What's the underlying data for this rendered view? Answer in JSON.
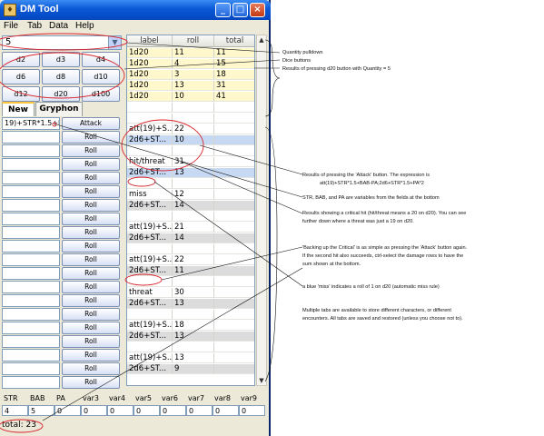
{
  "window": {
    "title": "DM Tool",
    "controls": [
      "_",
      "□",
      "×"
    ]
  },
  "menu": [
    "File",
    "Tab",
    "Data",
    "Help"
  ],
  "quantity": {
    "value": "5"
  },
  "dice": [
    "d2",
    "d3",
    "d4",
    "d6",
    "d8",
    "d10",
    "d12",
    "d20",
    "d100"
  ],
  "tabs": [
    "New",
    "Gryphon"
  ],
  "expressions": [
    {
      "text": "19)+STR*1.5+l",
      "button": "Attack"
    },
    {
      "text": "",
      "button": "Roll"
    },
    {
      "text": "",
      "button": "Roll"
    },
    {
      "text": "",
      "button": "Roll"
    },
    {
      "text": "",
      "button": "Roll"
    },
    {
      "text": "",
      "button": "Roll"
    },
    {
      "text": "",
      "button": "Roll"
    },
    {
      "text": "",
      "button": "Roll"
    },
    {
      "text": "",
      "button": "Roll"
    },
    {
      "text": "",
      "button": "Roll"
    },
    {
      "text": "",
      "button": "Roll"
    },
    {
      "text": "",
      "button": "Roll"
    },
    {
      "text": "",
      "button": "Roll"
    },
    {
      "text": "",
      "button": "Roll"
    },
    {
      "text": "",
      "button": "Roll"
    },
    {
      "text": "",
      "button": "Roll"
    },
    {
      "text": "",
      "button": "Roll"
    },
    {
      "text": "",
      "button": "Roll"
    },
    {
      "text": "",
      "button": "Roll"
    },
    {
      "text": "",
      "button": "Roll"
    }
  ],
  "table": {
    "headers": [
      "label",
      "roll",
      "total"
    ],
    "rows": [
      {
        "label": "1d20",
        "roll": "11",
        "total": "11",
        "style": "yellow"
      },
      {
        "label": "1d20",
        "roll": "4",
        "total": "15",
        "style": "yellow"
      },
      {
        "label": "1d20",
        "roll": "3",
        "total": "18",
        "style": "yellow"
      },
      {
        "label": "1d20",
        "roll": "13",
        "total": "31",
        "style": "yellow"
      },
      {
        "label": "1d20",
        "roll": "10",
        "total": "41",
        "style": "yellow"
      },
      {
        "label": "",
        "roll": "",
        "total": "",
        "style": "white"
      },
      {
        "label": "",
        "roll": "",
        "total": "",
        "style": "white"
      },
      {
        "label": "att(19)+S...",
        "roll": "22",
        "total": "",
        "style": "white"
      },
      {
        "label": "2d6+ST...",
        "roll": "10",
        "total": "",
        "style": "blue"
      },
      {
        "label": "",
        "roll": "",
        "total": "",
        "style": "white"
      },
      {
        "label": "hit/threat",
        "roll": "31",
        "total": "",
        "style": "white"
      },
      {
        "label": "2d6+ST...",
        "roll": "13",
        "total": "",
        "style": "blue"
      },
      {
        "label": "",
        "roll": "",
        "total": "",
        "style": "white"
      },
      {
        "label": "miss",
        "roll": "12",
        "total": "",
        "style": "white"
      },
      {
        "label": "2d6+ST...",
        "roll": "14",
        "total": "",
        "style": "gray"
      },
      {
        "label": "",
        "roll": "",
        "total": "",
        "style": "white"
      },
      {
        "label": "att(19)+S...",
        "roll": "21",
        "total": "",
        "style": "white"
      },
      {
        "label": "2d6+ST...",
        "roll": "14",
        "total": "",
        "style": "gray"
      },
      {
        "label": "",
        "roll": "",
        "total": "",
        "style": "white"
      },
      {
        "label": "att(19)+S...",
        "roll": "22",
        "total": "",
        "style": "white"
      },
      {
        "label": "2d6+ST...",
        "roll": "11",
        "total": "",
        "style": "gray"
      },
      {
        "label": "",
        "roll": "",
        "total": "",
        "style": "white"
      },
      {
        "label": "threat",
        "roll": "30",
        "total": "",
        "style": "white"
      },
      {
        "label": "2d6+ST...",
        "roll": "13",
        "total": "",
        "style": "gray"
      },
      {
        "label": "",
        "roll": "",
        "total": "",
        "style": "white"
      },
      {
        "label": "att(19)+S...",
        "roll": "18",
        "total": "",
        "style": "white"
      },
      {
        "label": "2d6+ST...",
        "roll": "13",
        "total": "",
        "style": "gray"
      },
      {
        "label": "",
        "roll": "",
        "total": "",
        "style": "white"
      },
      {
        "label": "att(19)+S...",
        "roll": "13",
        "total": "",
        "style": "white"
      },
      {
        "label": "2d6+ST...",
        "roll": "9",
        "total": "",
        "style": "gray"
      }
    ]
  },
  "variables": {
    "names": [
      "STR",
      "BAB",
      "PA",
      "var3",
      "var4",
      "var5",
      "var6",
      "var7",
      "var8",
      "var9"
    ],
    "values": [
      "4",
      "5",
      "0",
      "0",
      "0",
      "0",
      "0",
      "0",
      "0",
      "0"
    ]
  },
  "total": "total: 23",
  "annotations": {
    "quantity": "Quantity pulldown",
    "dice": "Dice buttons",
    "results": "Results of pressing d20 button with Quantity = 5",
    "attack_1": "Results of pressing the 'Attack' button. The expression is",
    "attack_2": "att(19)+STR*1.5+BAB-PA;2d6+STR*1.5+PA*2",
    "vars": "STR, BAB, and PA are variables from the fields at the bottom",
    "crit_1": "Results showing a critical hit (hit/threat means a 20 on d20). You can see",
    "crit_2": "further down where a threat was just a 19 on d20.",
    "backup_1": "'Backing up the Critical' is as simple as pressing the 'Attack' button again.",
    "backup_2": "If the second hit also succeeds, ctrl-select the damage rows to have the",
    "backup_3": "sum shown at the bottom.",
    "miss": "a blue 'miss' indicates a roll of 1 on d20 (automatic miss rule)",
    "tabs_1": "Multiple tabs are available to store different characters, or different",
    "tabs_2": "encounters. All tabs are saved and restored (unless you choose not to)."
  },
  "colors": {
    "yellow_row": "#fff8cc",
    "blue_row": "#c6d8f2",
    "gray_row": "#dcdcdc",
    "annotation_red": "#d9222a"
  }
}
